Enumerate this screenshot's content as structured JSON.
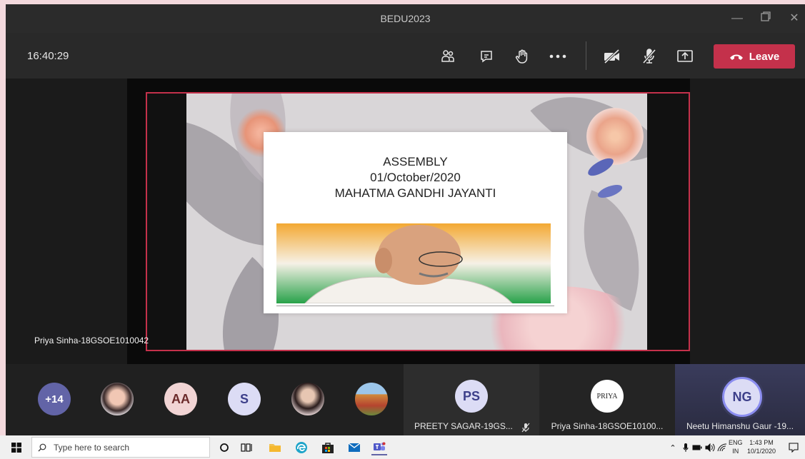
{
  "window": {
    "title": "BEDU2023"
  },
  "toolbar": {
    "time": "16:40:29",
    "leave_label": "Leave"
  },
  "slide": {
    "line1": "ASSEMBLY",
    "line2": "01/October/2020",
    "line3": "MAHATMA GANDHI JAYANTI"
  },
  "presenter": {
    "name": "Priya Sinha-18GSOE1010042"
  },
  "participants": {
    "overflow_count": "+14",
    "avatar_aa": "AA",
    "avatar_s": "S",
    "preety": {
      "initials": "PS",
      "name": "PREETY SAGAR-19GS..."
    },
    "priya": {
      "initials": "PRIYA",
      "name": "Priya Sinha-18GSOE10100..."
    },
    "neetu": {
      "initials": "NG",
      "name": "Neetu Himanshu Gaur -19..."
    }
  },
  "taskbar": {
    "search_placeholder": "Type here to search",
    "lang_top": "ENG",
    "lang_bottom": "IN",
    "time": "1:43 PM",
    "date": "10/1/2020"
  },
  "colors": {
    "leave": "#c4314b",
    "accent": "#6264a7"
  }
}
